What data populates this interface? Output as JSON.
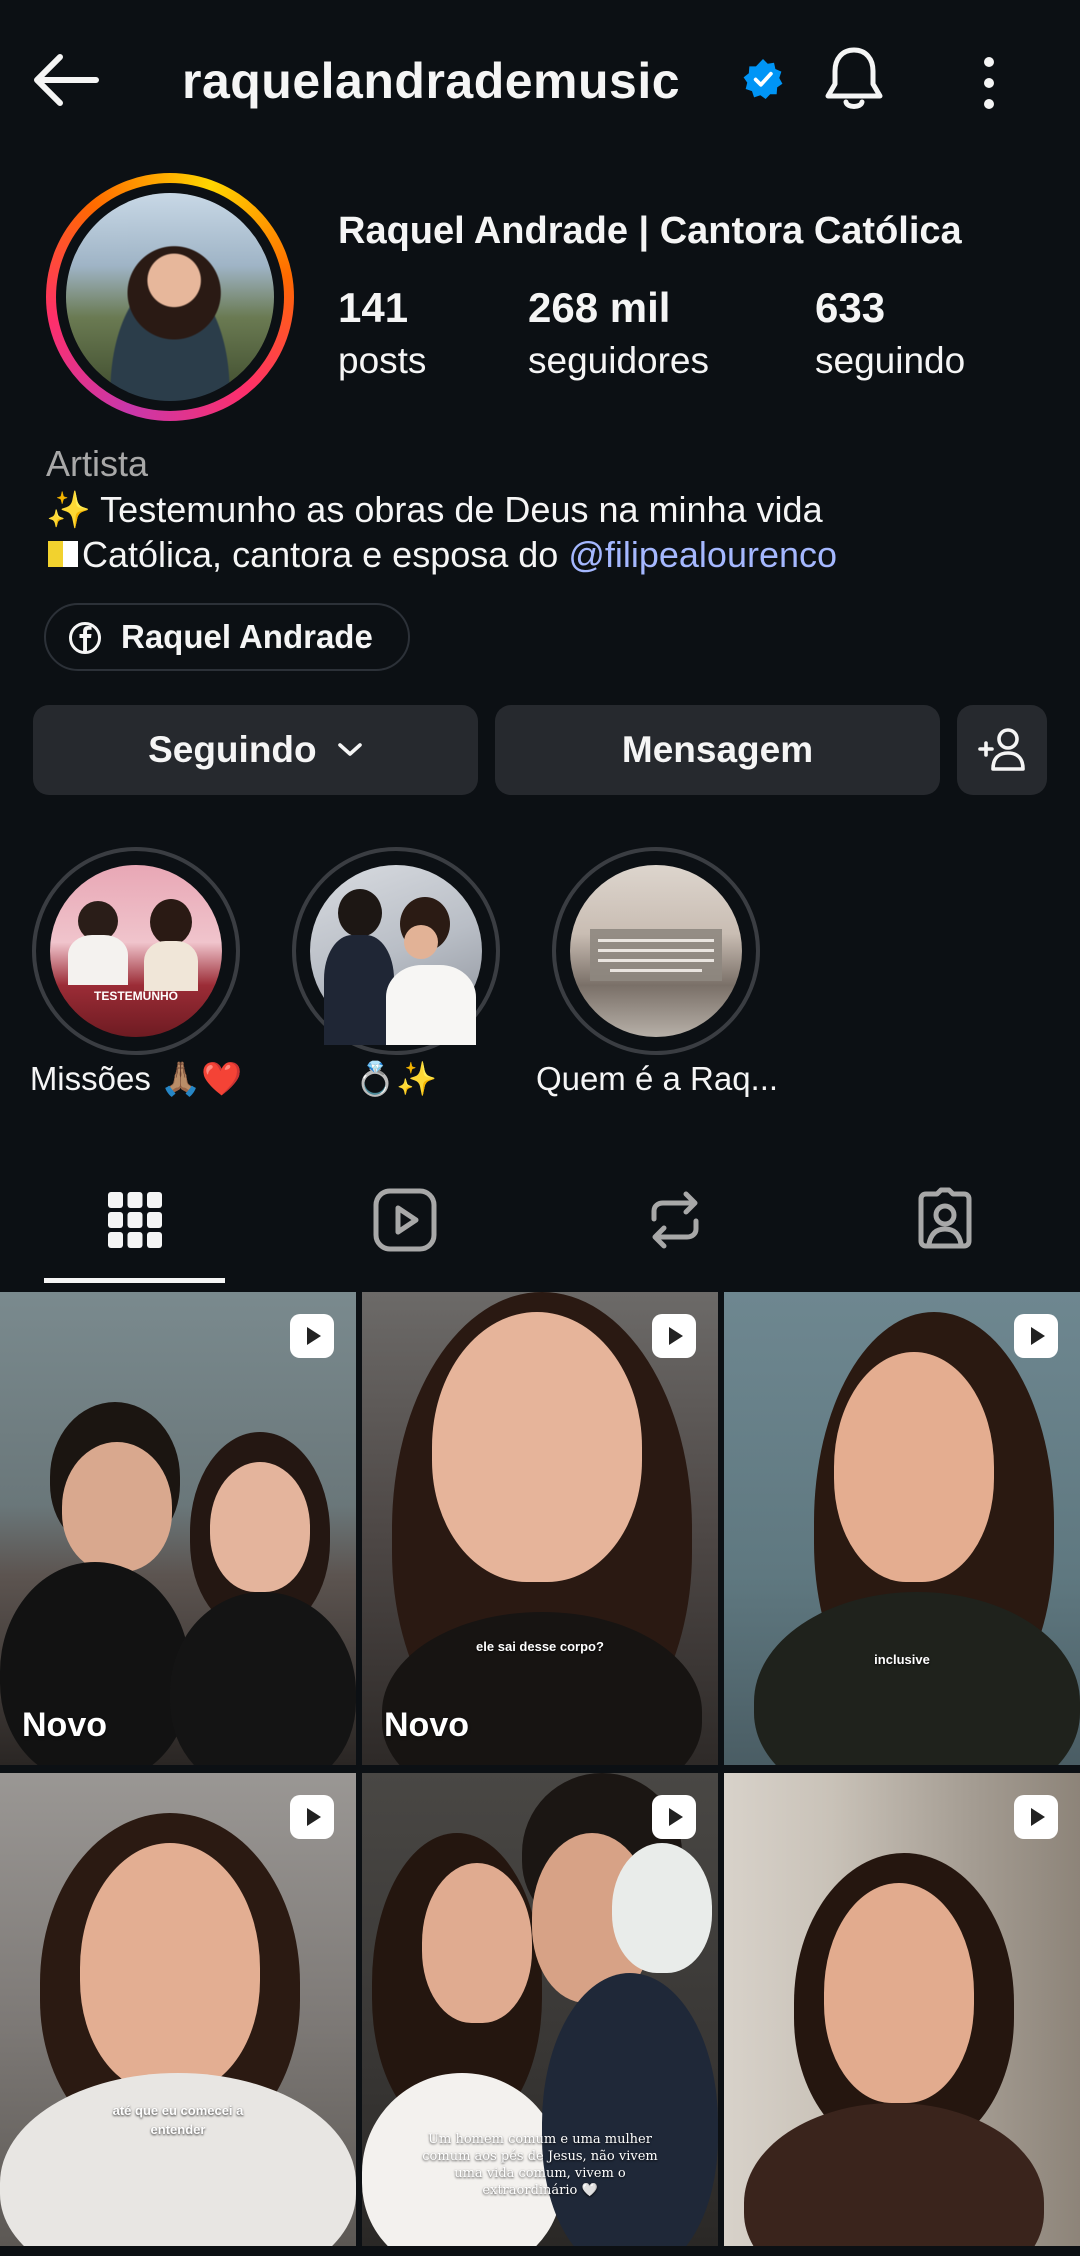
{
  "header": {
    "username": "raquelandrademusic",
    "icons": [
      "back-arrow-icon",
      "verified-badge-icon",
      "bell-icon",
      "more-vertical-icon"
    ]
  },
  "profile": {
    "display_name": "Raquel Andrade | Cantora Católica",
    "stats": [
      {
        "value": "141",
        "label": "posts"
      },
      {
        "value": "268 mil",
        "label": "seguidores"
      },
      {
        "value": "633",
        "label": "seguindo"
      }
    ],
    "category": "Artista",
    "bio_line1": "✨ Testemunho as obras de Deus na minha vida",
    "bio_line2_text": "Católica, cantora e esposa do ",
    "bio_mention": "@filipealourenco",
    "link_label": "Raquel Andrade"
  },
  "actions": {
    "following_label": "Seguindo",
    "message_label": "Mensagem"
  },
  "highlights": [
    {
      "label": "Missões 🙏🏽❤️"
    },
    {
      "label": "💍✨"
    },
    {
      "label": "Quem é a Raq..."
    }
  ],
  "highlight_texts": {
    "h1_badge": "TESTEMUNHO"
  },
  "tabs": [
    "grid-icon",
    "reels-icon",
    "reposts-icon",
    "tagged-icon"
  ],
  "grid": [
    {
      "badge": "Novo",
      "caption": ""
    },
    {
      "badge": "Novo",
      "caption": "ele sai desse corpo?"
    },
    {
      "badge": "",
      "caption": "inclusive"
    },
    {
      "badge": "",
      "caption": "até que eu comecei a entender"
    },
    {
      "badge": "",
      "caption": "Um homem comum e uma mulher comum aos pés de Jesus, não vivem uma vida comum, vivem o extraordinário 🤍"
    },
    {
      "badge": "",
      "caption": ""
    }
  ],
  "colors": {
    "background": "#0c1014",
    "button": "#26292e",
    "mention": "#a5b8ff",
    "verified": "#0095f6"
  }
}
